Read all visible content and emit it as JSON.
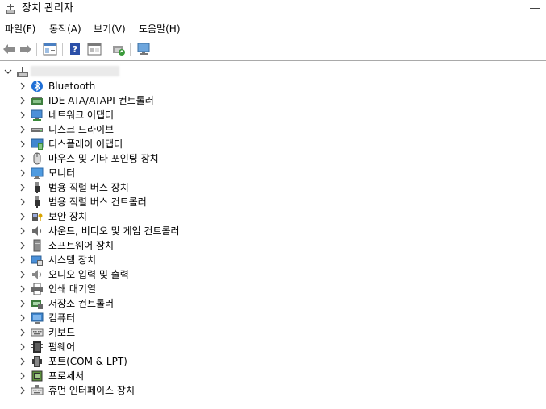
{
  "window": {
    "title": "장치 관리자"
  },
  "menu": [
    {
      "label": "파일(F)"
    },
    {
      "label": "동작(A)"
    },
    {
      "label": "보기(V)"
    },
    {
      "label": "도움말(H)"
    }
  ],
  "toolbar": {
    "buttons": [
      "back-icon",
      "forward-icon",
      "properties-icon",
      "help-icon",
      "view-icon",
      "update-driver-icon",
      "scan-hardware-icon"
    ]
  },
  "tree": {
    "root": {
      "name_blurred": true
    },
    "categories": [
      {
        "label": "Bluetooth",
        "icon": "bluetooth-icon"
      },
      {
        "label": "IDE ATA/ATAPI 컨트롤러",
        "icon": "ide-controller-icon"
      },
      {
        "label": "네트워크 어댑터",
        "icon": "network-adapter-icon"
      },
      {
        "label": "디스크 드라이브",
        "icon": "disk-drive-icon"
      },
      {
        "label": "디스플레이 어댑터",
        "icon": "display-adapter-icon"
      },
      {
        "label": "마우스 및 기타 포인팅 장치",
        "icon": "mouse-icon"
      },
      {
        "label": "모니터",
        "icon": "monitor-icon"
      },
      {
        "label": "범용 직렬 버스 장치",
        "icon": "usb-device-icon"
      },
      {
        "label": "범용 직렬 버스 컨트롤러",
        "icon": "usb-controller-icon"
      },
      {
        "label": "보안 장치",
        "icon": "security-device-icon"
      },
      {
        "label": "사운드, 비디오 및 게임 컨트롤러",
        "icon": "sound-controller-icon"
      },
      {
        "label": "소프트웨어 장치",
        "icon": "software-device-icon"
      },
      {
        "label": "시스템 장치",
        "icon": "system-device-icon"
      },
      {
        "label": "오디오 입력 및 출력",
        "icon": "audio-io-icon"
      },
      {
        "label": "인쇄 대기열",
        "icon": "print-queue-icon"
      },
      {
        "label": "저장소 컨트롤러",
        "icon": "storage-controller-icon"
      },
      {
        "label": "컴퓨터",
        "icon": "computer-icon"
      },
      {
        "label": "키보드",
        "icon": "keyboard-icon"
      },
      {
        "label": "펌웨어",
        "icon": "firmware-icon"
      },
      {
        "label": "포트(COM & LPT)",
        "icon": "port-icon"
      },
      {
        "label": "프로세서",
        "icon": "processor-icon"
      },
      {
        "label": "휴먼 인터페이스 장치",
        "icon": "hid-icon"
      }
    ]
  }
}
